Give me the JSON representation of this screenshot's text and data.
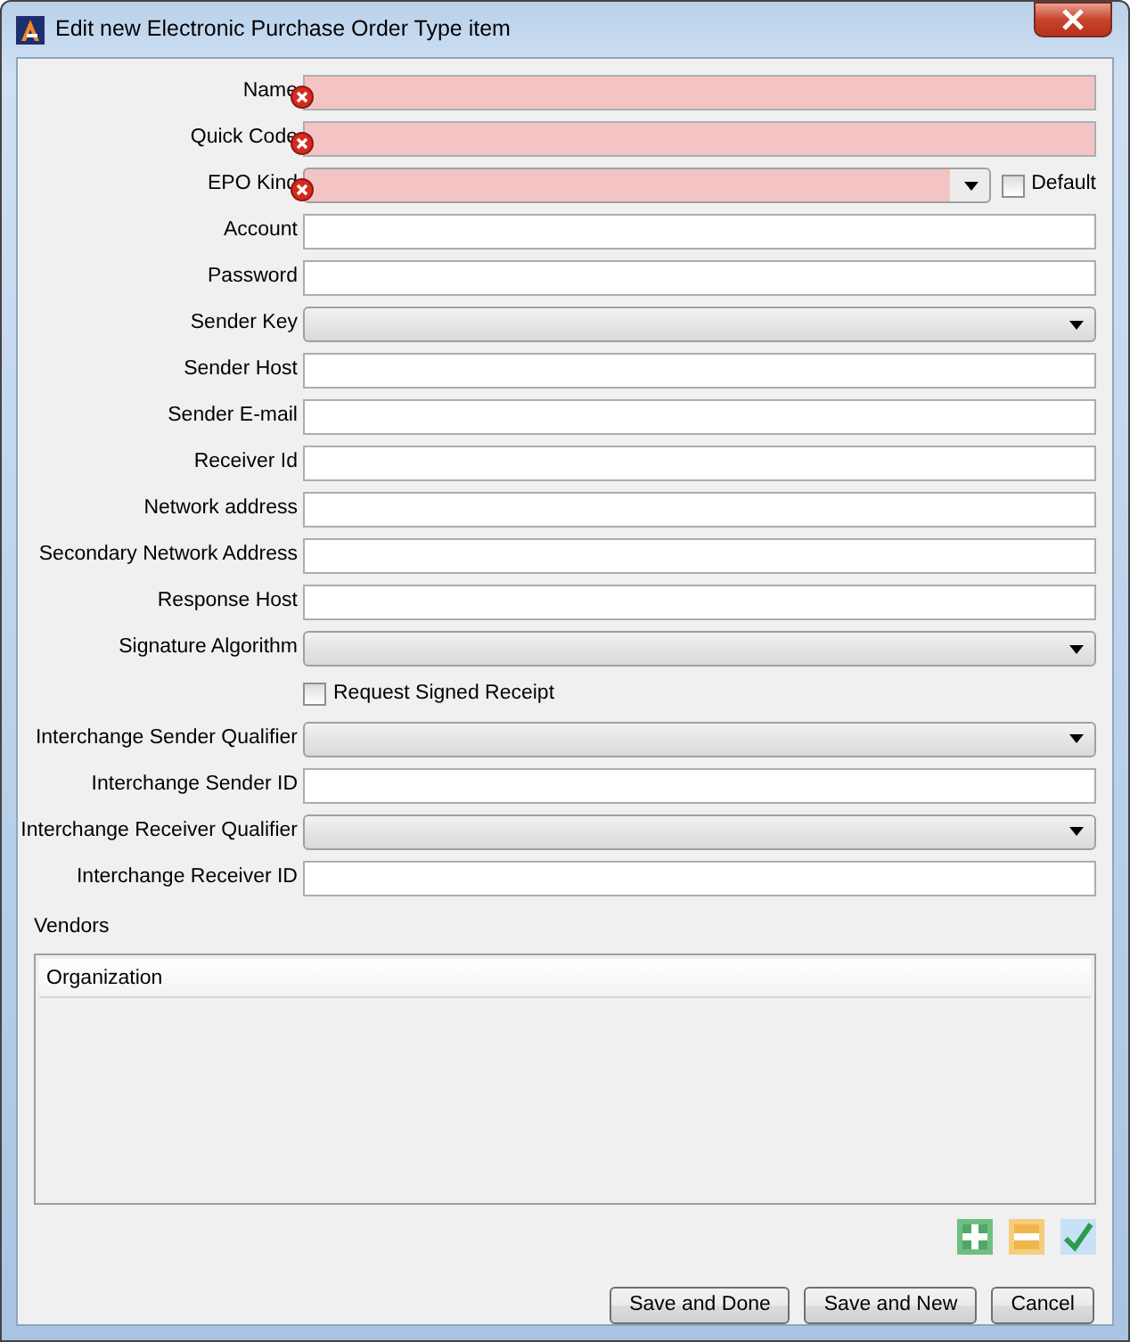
{
  "window": {
    "title": "Edit new Electronic Purchase Order Type item"
  },
  "fields": [
    {
      "kind": "text",
      "label": "Name",
      "error": true
    },
    {
      "kind": "text",
      "label": "Quick Code",
      "error": true
    },
    {
      "kind": "combo",
      "label": "EPO Kind",
      "error": true,
      "side_checkbox": {
        "label": "Default",
        "checked": false
      }
    },
    {
      "kind": "text",
      "label": "Account",
      "error": false
    },
    {
      "kind": "text",
      "label": "Password",
      "error": false
    },
    {
      "kind": "combo",
      "label": "Sender Key",
      "error": false
    },
    {
      "kind": "text",
      "label": "Sender Host",
      "error": false
    },
    {
      "kind": "text",
      "label": "Sender E-mail",
      "error": false
    },
    {
      "kind": "text",
      "label": "Receiver Id",
      "error": false
    },
    {
      "kind": "text",
      "label": "Network address",
      "error": false
    },
    {
      "kind": "text",
      "label": "Secondary Network Address",
      "error": false
    },
    {
      "kind": "text",
      "label": "Response Host",
      "error": false
    },
    {
      "kind": "combo",
      "label": "Signature Algorithm",
      "error": false
    },
    {
      "kind": "checkbox",
      "label": "Request Signed Receipt",
      "checked": false
    },
    {
      "kind": "combo",
      "label": "Interchange Sender Qualifier",
      "error": false
    },
    {
      "kind": "text",
      "label": "Interchange Sender ID",
      "error": false
    },
    {
      "kind": "combo",
      "label": "Interchange Receiver Qualifier",
      "error": false
    },
    {
      "kind": "text",
      "label": "Interchange Receiver ID",
      "error": false
    }
  ],
  "vendors": {
    "title": "Vendors",
    "columns": [
      "Organization"
    ]
  },
  "buttons": [
    "Save and Done",
    "Save and New",
    "Cancel"
  ]
}
